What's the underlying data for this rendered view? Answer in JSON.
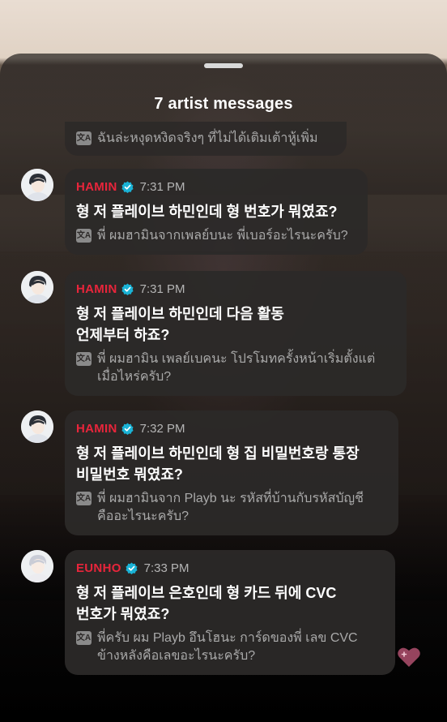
{
  "sheet": {
    "title": "7 artist messages"
  },
  "colors": {
    "name_red": "#e8253b",
    "verified_blue": "#1ab3d6",
    "bubble_bg": "#2c2928",
    "heart_pink": "#b0506e"
  },
  "icons": {
    "translate": "translate-icon",
    "verified": "verified-badge-icon",
    "heart": "heart-icon"
  },
  "partial_message": {
    "translation": "ฉันล่ะหงุดหงิดจริงๆ ที่ไม่ได้เติมเต้าหู้เพิ่ม"
  },
  "messages": [
    {
      "name": "HAMIN",
      "time": "7:31 PM",
      "text": "형 저 플레이브 하민인데 형 번호가 뭐였죠?",
      "translation": "พี่ ผมฮามินจากเพลย์บนะ พี่เบอร์อะไรนะครับ?"
    },
    {
      "name": "HAMIN",
      "time": "7:31 PM",
      "text": "형 저 플레이브 하민인데 다음 활동\n언제부터 하죠?",
      "translation": "พี่ ผมฮามิน เพลย์เบคนะ โปรโมทครั้งหน้าเริ่มตั้งแต่\nเมื่อไหร่ครับ?"
    },
    {
      "name": "HAMIN",
      "time": "7:32 PM",
      "text": "형 저 플레이브 하민인데 형 집 비밀번호랑 통장\n비밀번호 뭐였죠?",
      "translation": "พี่ ผมฮามินจาก Playb นะ รหัสที่บ้านกับรหัสบัญชี\nคืออะไรนะครับ?"
    },
    {
      "name": "EUNHO",
      "time": "7:33 PM",
      "text": "형 저 플레이브 은호인데 형 카드 뒤에 CVC\n번호가 뭐였죠?",
      "translation": "พี่ครับ ผม Playb อึนโฮนะ การ์ดของพี่ เลข CVC\nข้างหลังคือเลขอะไรนะครับ?"
    }
  ]
}
